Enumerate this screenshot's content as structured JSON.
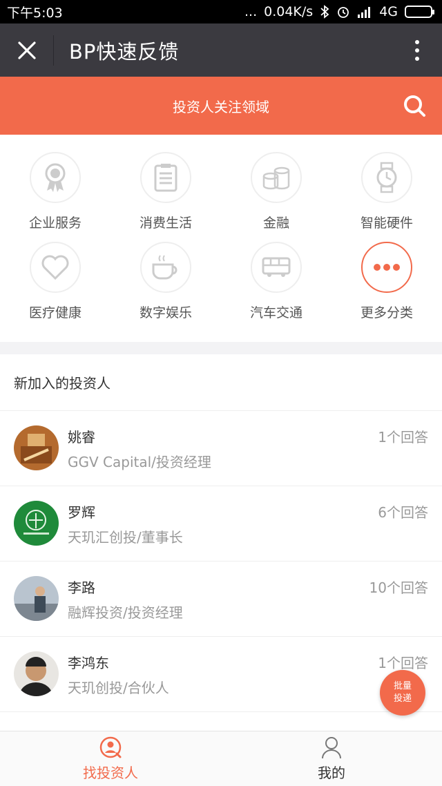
{
  "status_bar": {
    "time": "下午5:03",
    "dots": "...",
    "speed": "0.04K/s",
    "network": "4G"
  },
  "title_bar": {
    "title": "BP快速反馈"
  },
  "banner": {
    "text": "投资人关注领域"
  },
  "categories": [
    {
      "label": "企业服务",
      "icon": "award-ribbon-icon"
    },
    {
      "label": "消费生活",
      "icon": "clipboard-list-icon"
    },
    {
      "label": "金融",
      "icon": "coin-stack-icon"
    },
    {
      "label": "智能硬件",
      "icon": "smartwatch-icon"
    },
    {
      "label": "医疗健康",
      "icon": "heart-icon"
    },
    {
      "label": "数字娱乐",
      "icon": "coffee-cup-icon"
    },
    {
      "label": "汽车交通",
      "icon": "bus-icon"
    },
    {
      "label": "更多分类",
      "icon": "more-dots-icon"
    }
  ],
  "section": {
    "title": "新加入的投资人"
  },
  "investors": [
    {
      "name": "姚睿",
      "org": "GGV Capital/投资经理",
      "answers": "1个回答"
    },
    {
      "name": "罗辉",
      "org": "天玑汇创投/董事长",
      "answers": "6个回答"
    },
    {
      "name": "李路",
      "org": "融辉投资/投资经理",
      "answers": "10个回答"
    },
    {
      "name": "李鸿东",
      "org": "天玑创投/合伙人",
      "answers": "1个回答"
    }
  ],
  "fab": {
    "line1": "批量",
    "line2": "投递"
  },
  "tabs": [
    {
      "label": "找投资人",
      "icon": "investor-search-icon",
      "active": true
    },
    {
      "label": "我的",
      "icon": "person-icon",
      "active": false
    }
  ],
  "colors": {
    "accent": "#f26a4b",
    "titlebar": "#3b3a40"
  }
}
